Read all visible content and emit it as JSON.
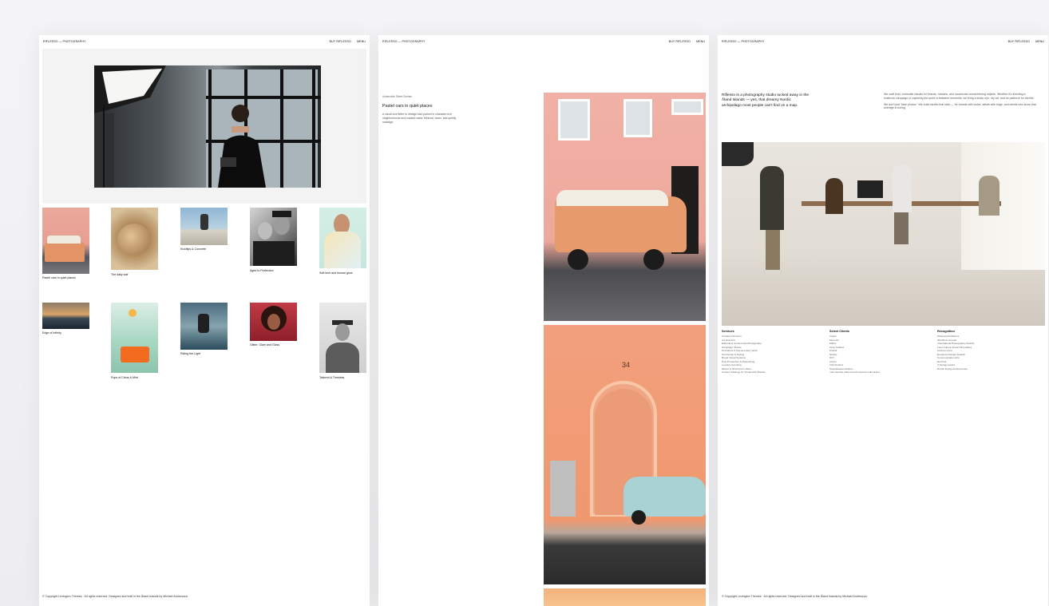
{
  "brand": "RIFLESSO — PHOTOGRAPHY",
  "nav": {
    "buy": "BUY RIFLESSO",
    "menu": "MENU"
  },
  "panel1": {
    "items": [
      {
        "caption": "Pastel cars in quiet places"
      },
      {
        "caption": "The daily loaf"
      },
      {
        "caption": "Kickflips & Concrete"
      },
      {
        "caption": "Aged to Perfection"
      },
      {
        "caption": "Soft tech and human glow"
      },
      {
        "caption": "Edge of Infinity"
      },
      {
        "caption": "Pops of Citrus & Mint"
      },
      {
        "caption": "Riding the Light"
      },
      {
        "caption": "Glitter, Glam and Gloss"
      },
      {
        "caption": "Tailored & Timeless"
      }
    ],
    "footer": "© Copyright Lexington Themes · All rights reserved. Designed and built in the Åland Islands by Michael Andreuzza."
  },
  "panel2": {
    "category": "Automotive Street Scenes",
    "title": "Pastel cars in quiet places",
    "description": "A visual love letter to vintage cars parked in character-rich neighborhoods and coastal roads. Minimal, warm, and quietly nostalgic.",
    "door_number": "34"
  },
  "panel3": {
    "intro": "Riflesso is a photography studio tucked away in the Åland Islands — yes, that dreamy Nordic archipelago most people can't find on a map.",
    "paragraphs": [
      "We craft bold, cinematic visuals for brands, humans, and occasional overachieving objects. Whether it's directing a lookbook campaign or capturing the quiet in-between moments, we bring a sharp eye, dry wit, and no patience for clichés.",
      "We don't just \"take photos.\" We build stories that stick — for brands with vision, artists with edge, and clients who know that average is boring."
    ],
    "columns": [
      {
        "heading": "Services",
        "items": [
          "Creative Direction",
          "Art Direction",
          "Editorial & Commercial Photography",
          "Campaign Shoots",
          "Portraiture & Documentary Work",
          "Set Design & Styling",
          "Brand Visual Systems",
          "Post Production & Retouching",
          "Location Scouting",
          "Motion & Short-Form Video",
          "Content Strategy for Visual-First Brands"
        ]
      },
      {
        "heading": "Select Clients",
        "items": [
          "Vogue",
          "Monocle",
          "KRFS",
          "Acne Studios",
          "Kinfolk",
          "Spotify",
          "HAY",
          "Aesop",
          "Visit Finland",
          "Scandinavian Airlines",
          "Your favorite indie brand's favorite indie brand"
        ]
      },
      {
        "heading": "Recognition",
        "items": [
          "Photoworld Masters",
          "IPA Photo Annual",
          "International Photography Awards",
          "Lens Culture Visual Storytelling",
          "Cannes Lions",
          "European Design Awards",
          "Communication Arts",
          "Red Dot",
          "It' Design award",
          "Nordic Design Achievement"
        ]
      }
    ],
    "footer": "© Copyright Lexington Themes · All rights reserved. Designed and built in the Åland Islands by Michael Andreuzza."
  }
}
